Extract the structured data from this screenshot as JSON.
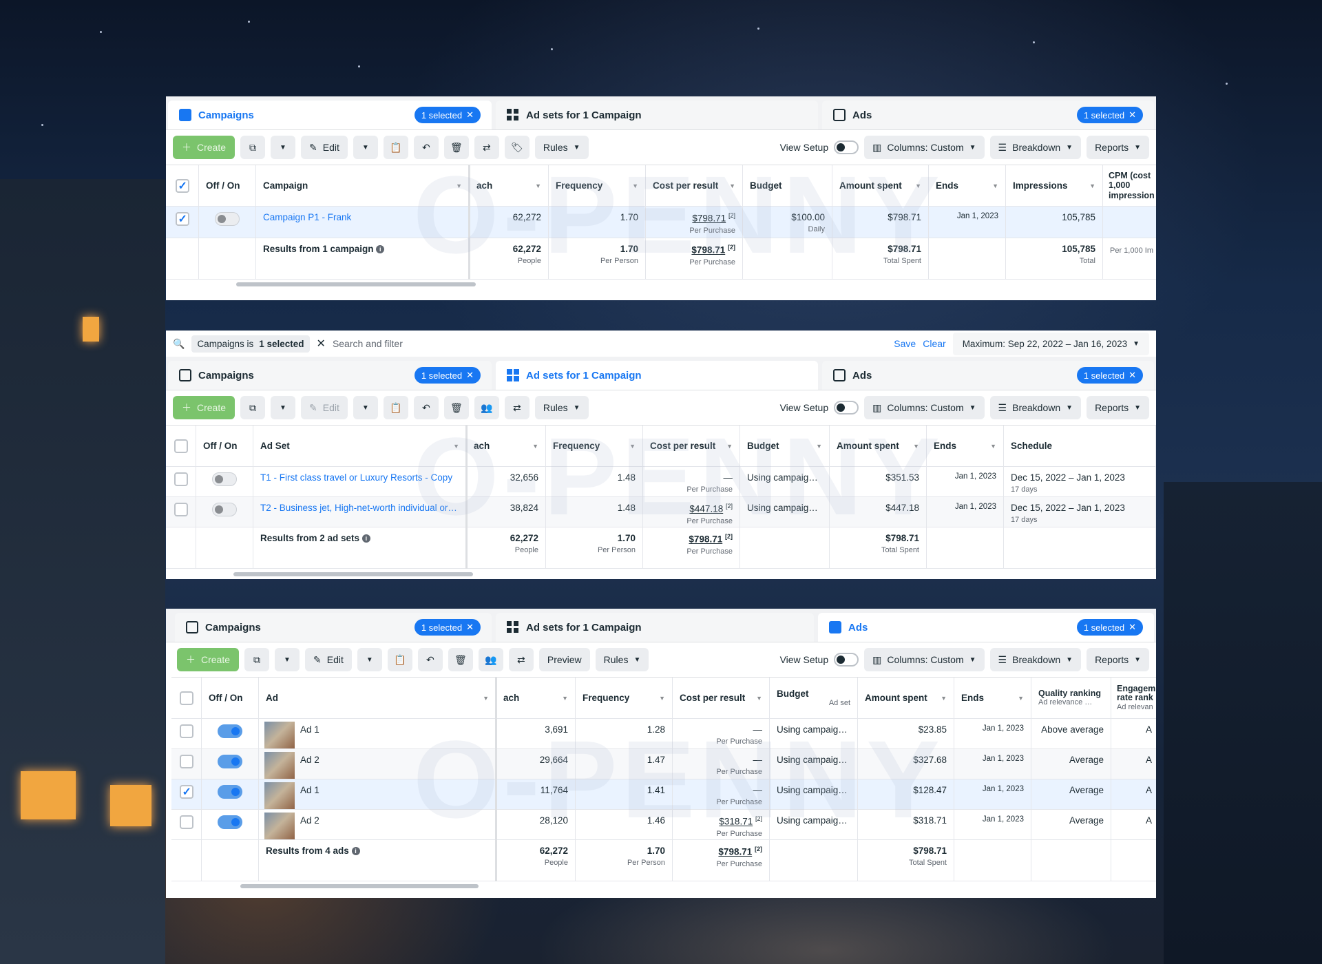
{
  "watermark": "O-PENNY",
  "tabs": {
    "campaigns": "Campaigns",
    "adsets": "Ad sets for 1 Campaign",
    "ads": "Ads",
    "selected": "1 selected"
  },
  "toolbar": {
    "create": "Create",
    "edit": "Edit",
    "rules": "Rules",
    "preview": "Preview",
    "view_setup": "View Setup",
    "columns": "Columns: Custom",
    "breakdown": "Breakdown",
    "reports": "Reports"
  },
  "filter": {
    "chip_prefix": "Campaigns is",
    "chip_value": "1 selected",
    "placeholder": "Search and filter",
    "save": "Save",
    "clear": "Clear",
    "date_range": "Maximum: Sep 22, 2022 – Jan 16, 2023"
  },
  "panel1": {
    "headers": [
      "Off / On",
      "Campaign",
      "ach",
      "Frequency",
      "Cost per result",
      "Budget",
      "Amount spent",
      "Ends",
      "Impressions",
      "CPM (cost 1,000 impression"
    ],
    "row": {
      "name": "Campaign P1 - Frank",
      "reach": "62,272",
      "frequency": "1.70",
      "cost": "$798.71",
      "cost_sub": "Per Purchase",
      "budget": "$100.00",
      "budget_sub": "Daily",
      "spent": "$798.71",
      "ends": "Jan 1, 2023",
      "impressions": "105,785"
    },
    "summary": {
      "label": "Results from 1 campaign",
      "reach": "62,272",
      "reach_sub": "People",
      "frequency": "1.70",
      "frequency_sub": "Per Person",
      "cost": "$798.71",
      "cost_sub": "Per Purchase",
      "spent": "$798.71",
      "spent_sub": "Total Spent",
      "impressions": "105,785",
      "impressions_sub": "Total",
      "cpm_sub": "Per 1,000 Im"
    }
  },
  "panel2": {
    "headers": [
      "Off / On",
      "Ad Set",
      "ach",
      "Frequency",
      "Cost per result",
      "Budget",
      "Amount spent",
      "Ends",
      "Schedule"
    ],
    "rows": [
      {
        "name": "T1 - First class travel or Luxury Resorts - Copy",
        "reach": "32,656",
        "frequency": "1.48",
        "cost": "—",
        "cost_sub": "Per Purchase",
        "budget": "Using campaig…",
        "spent": "$351.53",
        "ends": "Jan 1, 2023",
        "schedule": "Dec 15, 2022 – Jan 1, 2023",
        "schedule_sub": "17 days"
      },
      {
        "name": "T2 - Business jet, High-net-worth individual or…",
        "reach": "38,824",
        "frequency": "1.48",
        "cost": "$447.18",
        "cost_sub": "Per Purchase",
        "budget": "Using campaig…",
        "spent": "$447.18",
        "ends": "Jan 1, 2023",
        "schedule": "Dec 15, 2022 – Jan 1, 2023",
        "schedule_sub": "17 days"
      }
    ],
    "summary": {
      "label": "Results from 2 ad sets",
      "reach": "62,272",
      "reach_sub": "People",
      "frequency": "1.70",
      "frequency_sub": "Per Person",
      "cost": "$798.71",
      "cost_sub": "Per Purchase",
      "spent": "$798.71",
      "spent_sub": "Total Spent"
    }
  },
  "panel3": {
    "headers": [
      "Off / On",
      "Ad",
      "ach",
      "Frequency",
      "Cost per result",
      "Budget",
      "Ad set",
      "Amount spent",
      "Ends",
      "Quality ranking",
      "Ad relevance …",
      "Engagem rate rank",
      "Ad relevan"
    ],
    "rows": [
      {
        "name": "Ad 1",
        "reach": "3,691",
        "frequency": "1.28",
        "cost": "—",
        "cost_sub": "Per Purchase",
        "budget": "Using campaig…",
        "spent": "$23.85",
        "ends": "Jan 1, 2023",
        "quality": "Above average",
        "eng": "A"
      },
      {
        "name": "Ad 2",
        "reach": "29,664",
        "frequency": "1.47",
        "cost": "—",
        "cost_sub": "Per Purchase",
        "budget": "Using campaig…",
        "spent": "$327.68",
        "ends": "Jan 1, 2023",
        "quality": "Average",
        "eng": "A"
      },
      {
        "name": "Ad 1",
        "reach": "11,764",
        "frequency": "1.41",
        "cost": "—",
        "cost_sub": "Per Purchase",
        "budget": "Using campaig…",
        "spent": "$128.47",
        "ends": "Jan 1, 2023",
        "quality": "Average",
        "eng": "A"
      },
      {
        "name": "Ad 2",
        "reach": "28,120",
        "frequency": "1.46",
        "cost": "$318.71",
        "cost_sub": "Per Purchase",
        "budget": "Using campaig…",
        "spent": "$318.71",
        "ends": "Jan 1, 2023",
        "quality": "Average",
        "eng": "A"
      }
    ],
    "summary": {
      "label": "Results from 4 ads",
      "reach": "62,272",
      "reach_sub": "People",
      "frequency": "1.70",
      "frequency_sub": "Per Person",
      "cost": "$798.71",
      "cost_sub": "Per Purchase",
      "spent": "$798.71",
      "spent_sub": "Total Spent"
    }
  }
}
